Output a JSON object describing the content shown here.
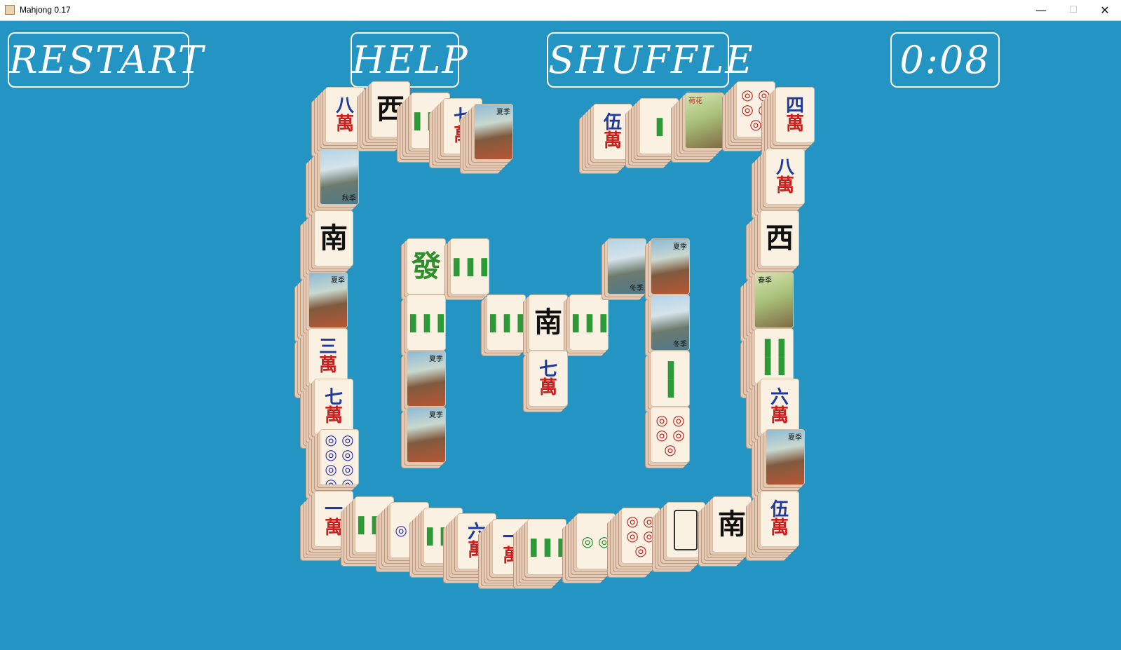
{
  "window": {
    "title": "Mahjong 0.17",
    "controls": {
      "minimize": "—",
      "maximize": "☐",
      "close": "✕"
    }
  },
  "hud": {
    "restart": "RESTART",
    "help": "HELP",
    "shuffle": "SHUFFLE",
    "timer": "0:08"
  },
  "tiles": {
    "t_ba": [
      "八",
      "萬"
    ],
    "t_xi": "西",
    "t_b6": "𝍩",
    "t_qi": [
      "七",
      "萬"
    ],
    "t_wu": [
      "伍",
      "萬"
    ],
    "t_b2": "‖",
    "t_d5": "◎ ◎ ◎ ◎ ◎",
    "t_si": [
      "四",
      "萬"
    ],
    "t_ba2": [
      "八",
      "萬"
    ],
    "t_nan": "南",
    "t_xi2": "西",
    "t_fa": "發",
    "t_san": [
      "三",
      "萬"
    ],
    "t_qi2": [
      "七",
      "萬"
    ],
    "t_d8": "◎ ◎ ◎ ◎ ◎ ◎ ◎ ◎",
    "t_yi": [
      "一",
      "萬"
    ],
    "t_liu": [
      "六",
      "萬"
    ],
    "t_yi2": [
      "一",
      "萬"
    ],
    "t_liu2": [
      "六",
      "萬"
    ],
    "t_wu2": [
      "伍",
      "萬"
    ],
    "t_nan2": "南",
    "t_nan3": "南",
    "t_qi3": [
      "七",
      "萬"
    ],
    "t_d2": "◎ ◎",
    "t_d2b": "◎ ◎",
    "t_d5b": "◎ ◎ ◎ ◎ ◎",
    "t_d5c": "◎ ◎ ◎ ◎ ◎",
    "cap_summer": "夏季",
    "cap_autumn": "秋季",
    "cap_winter": "冬季",
    "cap_spring": "春季",
    "cap_lotus": "荷花"
  }
}
